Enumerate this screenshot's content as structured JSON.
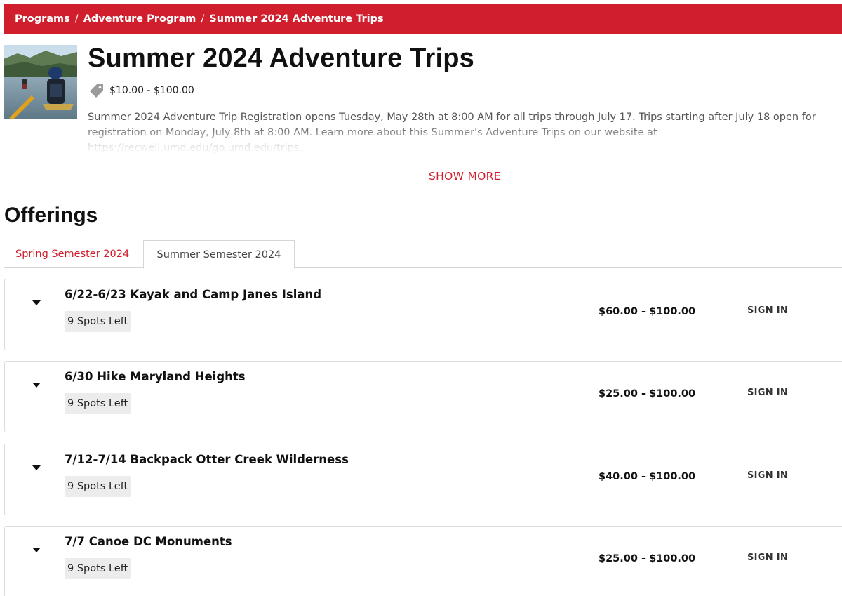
{
  "breadcrumb": {
    "items": [
      "Programs",
      "Adventure Program",
      "Summer 2024 Adventure Trips"
    ],
    "separator": "/"
  },
  "program": {
    "title": "Summer 2024 Adventure Trips",
    "price_range": "$10.00 - $100.00",
    "description": "Summer 2024 Adventure Trip Registration opens Tuesday, May 28th at 8:00 AM for all trips through July 17. Trips starting after July 18 open for registration on Monday, July 8th at 8:00 AM. Learn more about this Summer's Adventure Trips on our website at https://recwell.umd.edu/go.umd.edu/trips.",
    "show_more_label": "SHOW MORE"
  },
  "offerings": {
    "heading": "Offerings",
    "tabs": [
      {
        "label": "Spring Semester 2024",
        "active": false
      },
      {
        "label": "Summer Semester 2024",
        "active": true
      }
    ],
    "items": [
      {
        "name": "6/22-6/23 Kayak and Camp Janes Island",
        "spots": "9 Spots Left",
        "price": "$60.00 - $100.00",
        "action": "SIGN IN"
      },
      {
        "name": "6/30 Hike Maryland Heights",
        "spots": "9 Spots Left",
        "price": "$25.00 - $100.00",
        "action": "SIGN IN"
      },
      {
        "name": "7/12-7/14 Backpack Otter Creek Wilderness",
        "spots": "9 Spots Left",
        "price": "$40.00 - $100.00",
        "action": "SIGN IN"
      },
      {
        "name": "7/7 Canoe DC Monuments",
        "spots": "9 Spots Left",
        "price": "$25.00 - $100.00",
        "action": "SIGN IN"
      }
    ]
  },
  "colors": {
    "brand_red": "#d01e2c",
    "tag_icon_gray": "#9b9b9b"
  },
  "icons": {
    "price_tag": "tag-icon",
    "expand": "caret-down-icon"
  }
}
